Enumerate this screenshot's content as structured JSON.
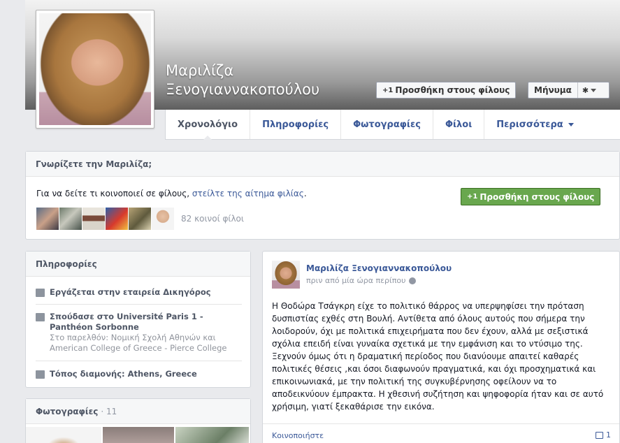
{
  "profile": {
    "name_line1": "Μαριλίζα",
    "name_line2": "Ξενογιαννακοπούλου"
  },
  "actions": {
    "add_friend": "Προσθήκη στους φίλους",
    "message": "Μήνυμα"
  },
  "tabs": [
    {
      "label": "Χρονολόγιο"
    },
    {
      "label": "Πληροφορίες"
    },
    {
      "label": "Φωτογραφίες"
    },
    {
      "label": "Φίλοι"
    },
    {
      "label": "Περισσότερα"
    }
  ],
  "know": {
    "title": "Γνωρίζετε την Μαριλίζα;",
    "text_prefix": "Για να δείτε τι κοινοποιεί σε φίλους, ",
    "text_link": "στείλτε της αίτημα φιλίας",
    "text_suffix": ".",
    "add_button": "Προσθήκη στους φίλους",
    "mutual": "82 κοινοί φίλοι"
  },
  "info": {
    "title": "Πληροφορίες",
    "work_prefix": "Εργάζεται στην εταιρεία ",
    "work_link": "Δικηγόρος",
    "study_prefix": "Σπούδασε στο ",
    "study_link": "Université Paris 1 - Panthéon Sorbonne",
    "study_past": "Στο παρελθόν: Νομική Σχολή Αθηνών και American College of Greece - Pierce College",
    "home_prefix": "Τόπος διαμονής: ",
    "home_link": "Athens, Greece"
  },
  "photos": {
    "title": "Φωτογραφίες",
    "count": "· 11"
  },
  "post": {
    "author": "Μαριλίζα Ξενογιαννακοπούλου",
    "time": "πριν από μία ώρα περίπου",
    "text": "Η Θοδώρα Τσάγκρη είχε το πολιτικό θάρρος να υπερψηφίσει την πρόταση δυσπιστίας εχθές στη Βουλή. Αντίθετα από όλους αυτούς που σήμερα την λοιδορούν, όχι με πολιτικά επιχειρήματα που δεν έχουν, αλλά με σεξιστικά σχόλια επειδή είναι γυναίκα σχετικά με την εμφάνιση και το ντύσιμο της. Ξεχνούν όμως ότι η δραματική περίοδος που διανύουμε απαιτεί καθαρές πολιτικές θέσεις ,και όσοι διαφωνούν πραγματικά, και όχι προσχηματικά και επικοινωνιακά, με την πολιτική της συγκυβέρνησης οφείλουν να το αποδεικνύουν έμπρακτα. Η χθεσινή συζήτηση και ψηφοφορία ήταν και σε αυτό χρήσιμη, γιατί ξεκαθάρισε την εικόνα.",
    "share": "Κοινοποιήστε",
    "comment_count": "1"
  },
  "colors": {
    "link": "#3b5998",
    "green_button": "#69a74e"
  }
}
